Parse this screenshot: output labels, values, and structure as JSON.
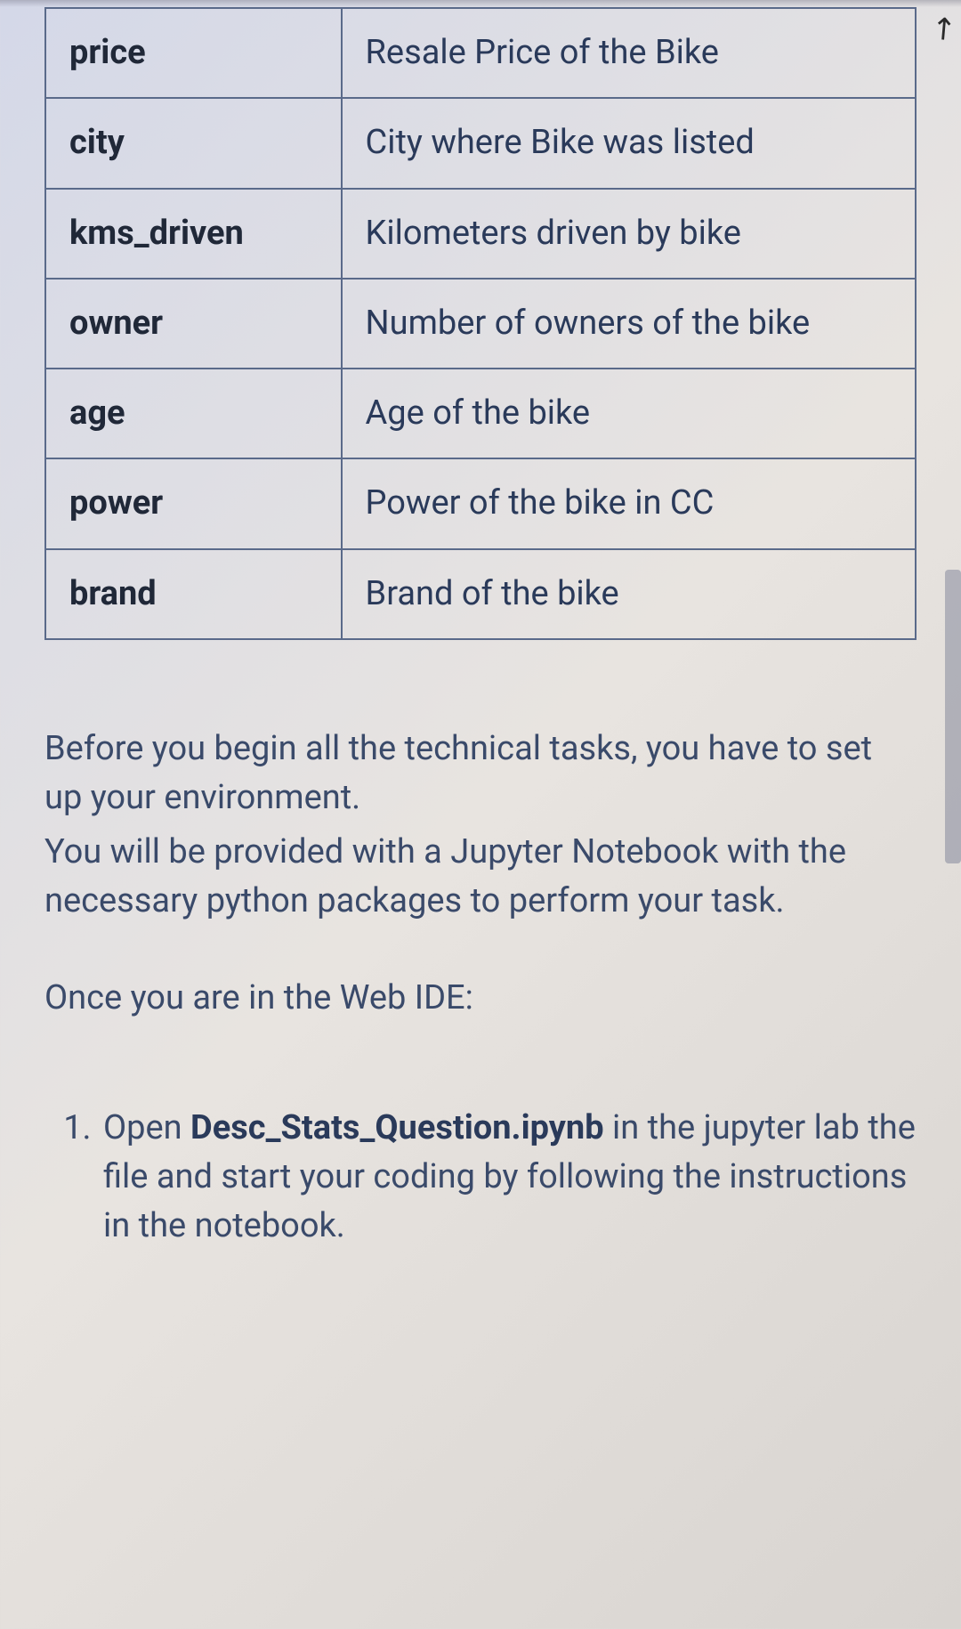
{
  "table": {
    "rows": [
      {
        "key": "price",
        "value": "Resale Price of the Bike"
      },
      {
        "key": "city",
        "value": "City where Bike was listed"
      },
      {
        "key": "kms_driven",
        "value": "Kilometers driven by bike"
      },
      {
        "key": "owner",
        "value": "Number of owners of the bike"
      },
      {
        "key": "age",
        "value": "Age of the bike"
      },
      {
        "key": "power",
        "value": "Power of the bike in CC"
      },
      {
        "key": "brand",
        "value": "Brand of the bike"
      }
    ]
  },
  "paragraphs": {
    "p1a": "Before you begin all the technical tasks, you have to set up your environment.",
    "p1b": "You will be provided with a Jupyter Notebook with the necessary python packages to perform your task.",
    "p2": "Once you are in the Web IDE:"
  },
  "steps": {
    "item1_prefix": "Open ",
    "item1_file": "Desc_Stats_Question.ipynb",
    "item1_suffix": " in the jupyter lab the file and  start your coding by following the instructions in the notebook."
  }
}
